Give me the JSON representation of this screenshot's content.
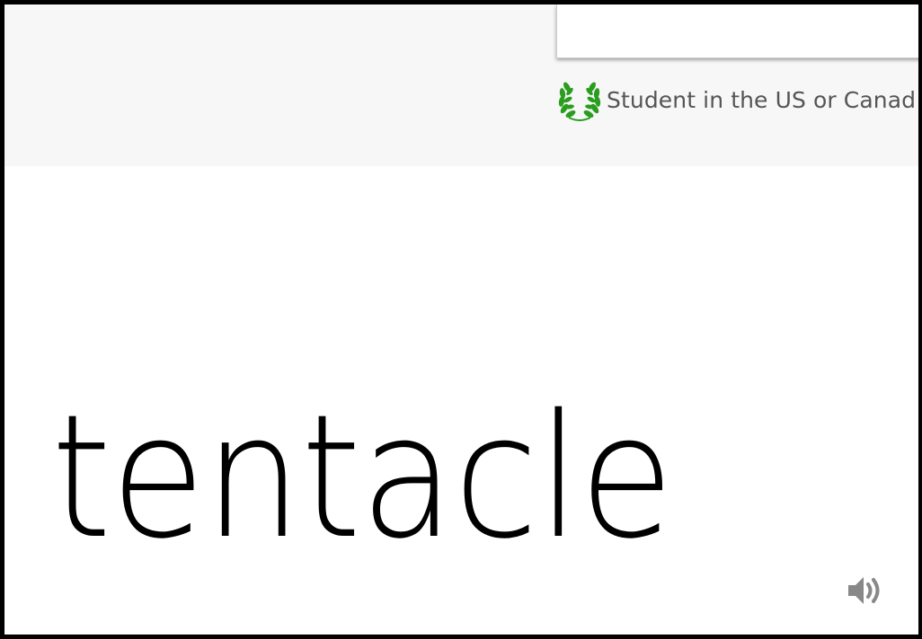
{
  "header": {
    "student_text": "Student in the US or Canad",
    "laurel_icon": "laurel-wreath-icon",
    "laurel_color": "#2a9d1f"
  },
  "entry": {
    "word": "tentacle",
    "audio_icon": "speaker-icon",
    "audio_icon_color": "#888888"
  },
  "colors": {
    "band_background": "#f7f7f7",
    "page_background": "#ffffff",
    "text_gray": "#555555"
  }
}
